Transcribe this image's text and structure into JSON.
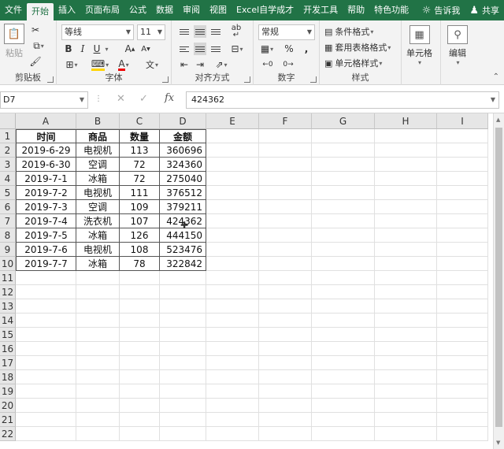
{
  "menu": {
    "tabs": [
      "文件",
      "开始",
      "插入",
      "页面布局",
      "公式",
      "数据",
      "审阅",
      "视图",
      "Excel自学成才",
      "开发工具",
      "帮助",
      "特色功能"
    ],
    "active_index": 1,
    "tell_me": "告诉我",
    "share": "共享"
  },
  "ribbon": {
    "clipboard": {
      "label": "剪贴板",
      "paste": "粘贴"
    },
    "font": {
      "label": "字体",
      "name": "等线",
      "size": "11",
      "bold": "B",
      "italic": "I",
      "underline": "U",
      "grow": "A",
      "shrink": "A",
      "font_color": "A",
      "phonetic": "文"
    },
    "alignment": {
      "label": "对齐方式",
      "wrap": "ab"
    },
    "number": {
      "label": "数字",
      "format": "常规",
      "percent": "%",
      "comma": ","
    },
    "styles": {
      "label": "样式",
      "conditional": "条件格式",
      "table": "套用表格格式",
      "cell_styles": "单元格样式"
    },
    "cells": {
      "label": "单元格"
    },
    "editing": {
      "label": "编辑"
    }
  },
  "formula_bar": {
    "name_box": "D7",
    "fx": "fx",
    "value": "424362"
  },
  "colors": {
    "brand": "#217346"
  },
  "sheet": {
    "columns": [
      "A",
      "B",
      "C",
      "D",
      "E",
      "F",
      "G",
      "H",
      "I"
    ],
    "rows": [
      "1",
      "2",
      "3",
      "4",
      "5",
      "6",
      "7",
      "8",
      "9",
      "10",
      "11",
      "12",
      "13",
      "14",
      "15",
      "16",
      "17",
      "18",
      "19",
      "20",
      "21",
      "22"
    ],
    "table": {
      "headers": [
        "时间",
        "商品",
        "数量",
        "金额"
      ],
      "rows": [
        [
          "2019-6-29",
          "电视机",
          "113",
          "360696"
        ],
        [
          "2019-6-30",
          "空调",
          "72",
          "324360"
        ],
        [
          "2019-7-1",
          "冰箱",
          "72",
          "275040"
        ],
        [
          "2019-7-2",
          "电视机",
          "111",
          "376512"
        ],
        [
          "2019-7-3",
          "空调",
          "109",
          "379211"
        ],
        [
          "2019-7-4",
          "洗衣机",
          "107",
          "424362"
        ],
        [
          "2019-7-5",
          "冰箱",
          "126",
          "444150"
        ],
        [
          "2019-7-6",
          "电视机",
          "108",
          "523476"
        ],
        [
          "2019-7-7",
          "冰箱",
          "78",
          "322842"
        ]
      ]
    }
  }
}
